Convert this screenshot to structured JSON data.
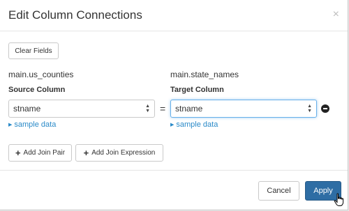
{
  "dialog": {
    "title": "Edit Column Connections",
    "close_glyph": "×"
  },
  "toolbar": {
    "clear_fields_label": "Clear Fields"
  },
  "source": {
    "table_name": "main.us_counties",
    "column_label": "Source Column",
    "selected_value": "stname",
    "sample_link": "sample data"
  },
  "target": {
    "table_name": "main.state_names",
    "column_label": "Target Column",
    "selected_value": "stname",
    "sample_link": "sample data"
  },
  "operator": "=",
  "actions": {
    "add_join_pair_label": "Add Join Pair",
    "add_join_expression_label": "Add Join Expression"
  },
  "footer": {
    "cancel_label": "Cancel",
    "apply_label": "Apply"
  },
  "colors": {
    "primary": "#2e6da4",
    "link": "#2a8ac8",
    "focus": "#66afe9"
  },
  "icons": {
    "close": "close-icon",
    "plus": "plus-icon",
    "remove": "remove-circle-icon",
    "select_arrows": "select-arrows-icon",
    "disclosure": "caret-right-icon",
    "cursor": "hand-pointer-icon"
  }
}
